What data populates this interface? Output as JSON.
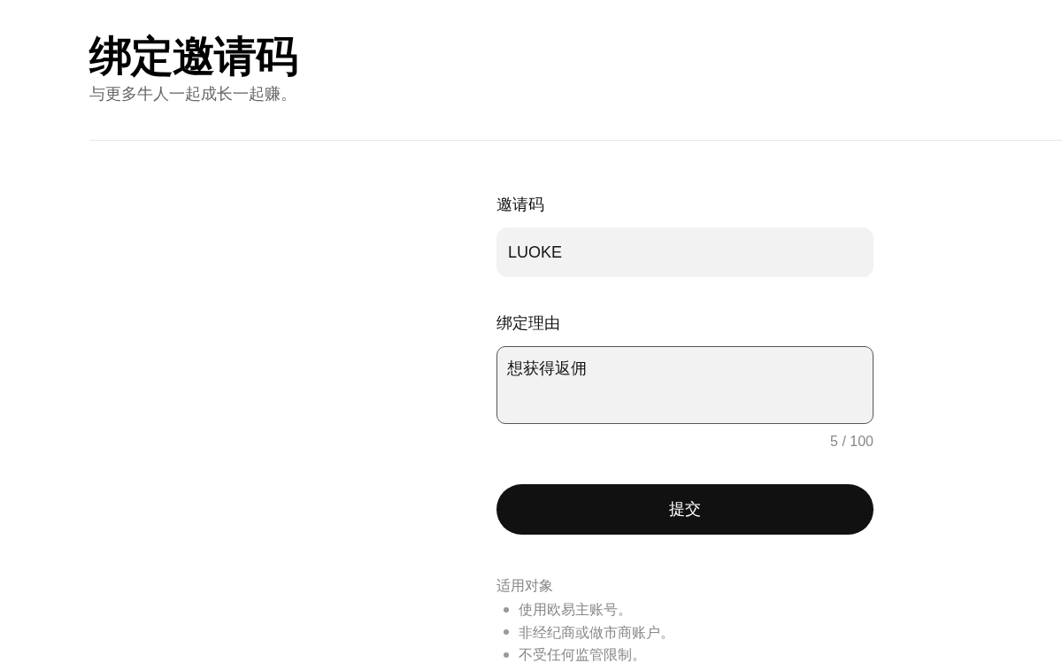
{
  "header": {
    "title": "绑定邀请码",
    "subtitle": "与更多牛人一起成长一起赚。"
  },
  "form": {
    "fields": [
      {
        "kind": "input",
        "label": "邀请码",
        "value": "LUOKE",
        "focused": false
      },
      {
        "kind": "textarea",
        "label": "绑定理由",
        "value": "想获得返佣",
        "focused": true,
        "counter": "5 / 100"
      }
    ],
    "submit_button": "提交"
  },
  "eligibility": {
    "title": "适用对象",
    "items": [
      "使用欧易主账号。",
      "非经纪商或做市商账户。",
      "不受任何监管限制。"
    ]
  }
}
